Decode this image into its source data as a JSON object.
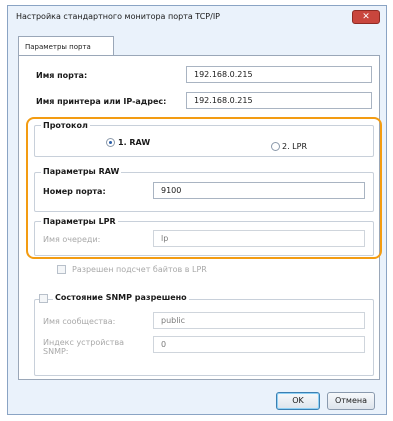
{
  "window": {
    "title": "Настройка стандартного монитора порта TCP/IP",
    "close_glyph": "✕"
  },
  "tabs": [
    {
      "label": "Параметры порта"
    }
  ],
  "port_name": {
    "label": "Имя порта:",
    "value": "192.168.0.215"
  },
  "printer_name": {
    "label": "Имя принтера или IP-адрес:",
    "value": "192.168.0.215"
  },
  "protocol": {
    "label": "Протокол",
    "options": [
      {
        "label": "1. RAW",
        "checked": true
      },
      {
        "label": "2. LPR",
        "checked": false
      }
    ]
  },
  "raw_settings": {
    "label": "Параметры RAW",
    "port_number_label": "Номер порта:",
    "port_number_value": "9100"
  },
  "lpr_settings": {
    "label": "Параметры LPR",
    "queue_name_label": "Имя очереди:",
    "queue_name_value": "lp"
  },
  "lpr_byte_counting": {
    "label": "Разрешен подсчет байтов в LPR",
    "checked": false
  },
  "snmp": {
    "status_label": "Состояние SNMP разрешено",
    "status_checked": false,
    "community_label": "Имя сообщества:",
    "community_value": "public",
    "device_index_label_line1": "Индекс устройства",
    "device_index_label_line2": "SNMP:",
    "device_index_value": "0"
  },
  "buttons": {
    "ok": "OK",
    "cancel": "Отмена"
  },
  "colors": {
    "highlight": "#f39c12",
    "close_button": "#c9463d",
    "window_background": "#eaf2fb"
  }
}
